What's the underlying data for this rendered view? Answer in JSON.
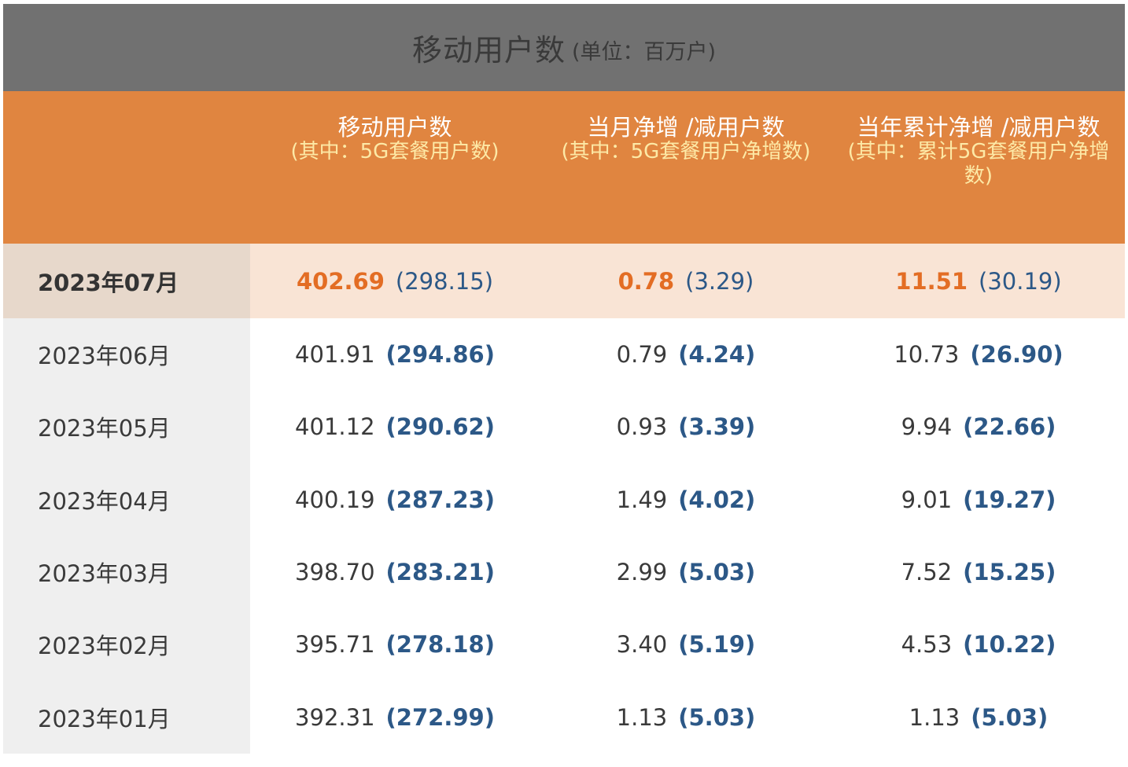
{
  "title": {
    "main": "移动用户数",
    "unit": "(单位：百万户)"
  },
  "header": {
    "col1": {
      "main": "移动用户数",
      "sub": "(其中：5G套餐用户数)"
    },
    "col2": {
      "main": "当月净增 /减用户数",
      "sub": "(其中：5G套餐用户净增数)"
    },
    "col3": {
      "main": "当年累计净增 /减用户数",
      "sub": "(其中：累计5G套餐用户净增数)"
    }
  },
  "rows": [
    {
      "date": "2023年07月",
      "c1": "402.69",
      "c1p": "(298.15)",
      "c2": "0.78",
      "c2p": "(3.29)",
      "c3": "11.51",
      "c3p": "(30.19)"
    },
    {
      "date": "2023年06月",
      "c1": "401.91",
      "c1p": "(294.86)",
      "c2": "0.79",
      "c2p": "(4.24)",
      "c3": "10.73",
      "c3p": "(26.90)"
    },
    {
      "date": "2023年05月",
      "c1": "401.12",
      "c1p": "(290.62)",
      "c2": "0.93",
      "c2p": "(3.39)",
      "c3": "9.94",
      "c3p": "(22.66)"
    },
    {
      "date": "2023年04月",
      "c1": "400.19",
      "c1p": "(287.23)",
      "c2": "1.49",
      "c2p": "(4.02)",
      "c3": "9.01",
      "c3p": "(19.27)"
    },
    {
      "date": "2023年03月",
      "c1": "398.70",
      "c1p": "(283.21)",
      "c2": "2.99",
      "c2p": "(5.03)",
      "c3": "7.52",
      "c3p": "(15.25)"
    },
    {
      "date": "2023年02月",
      "c1": "395.71",
      "c1p": "(278.18)",
      "c2": "3.40",
      "c2p": "(5.19)",
      "c3": "4.53",
      "c3p": "(10.22)"
    },
    {
      "date": "2023年01月",
      "c1": "392.31",
      "c1p": "(272.99)",
      "c2": "1.13",
      "c2p": "(5.03)",
      "c3": "1.13",
      "c3p": "(5.03)"
    }
  ],
  "colors": {
    "title_bg": "#717171",
    "header_bg": "#e08540",
    "header_sub_text": "#fde9a6",
    "highlight_bg": "#f9e4d5",
    "highlight_value": "#e36d24",
    "paren_value": "#2c5887"
  }
}
